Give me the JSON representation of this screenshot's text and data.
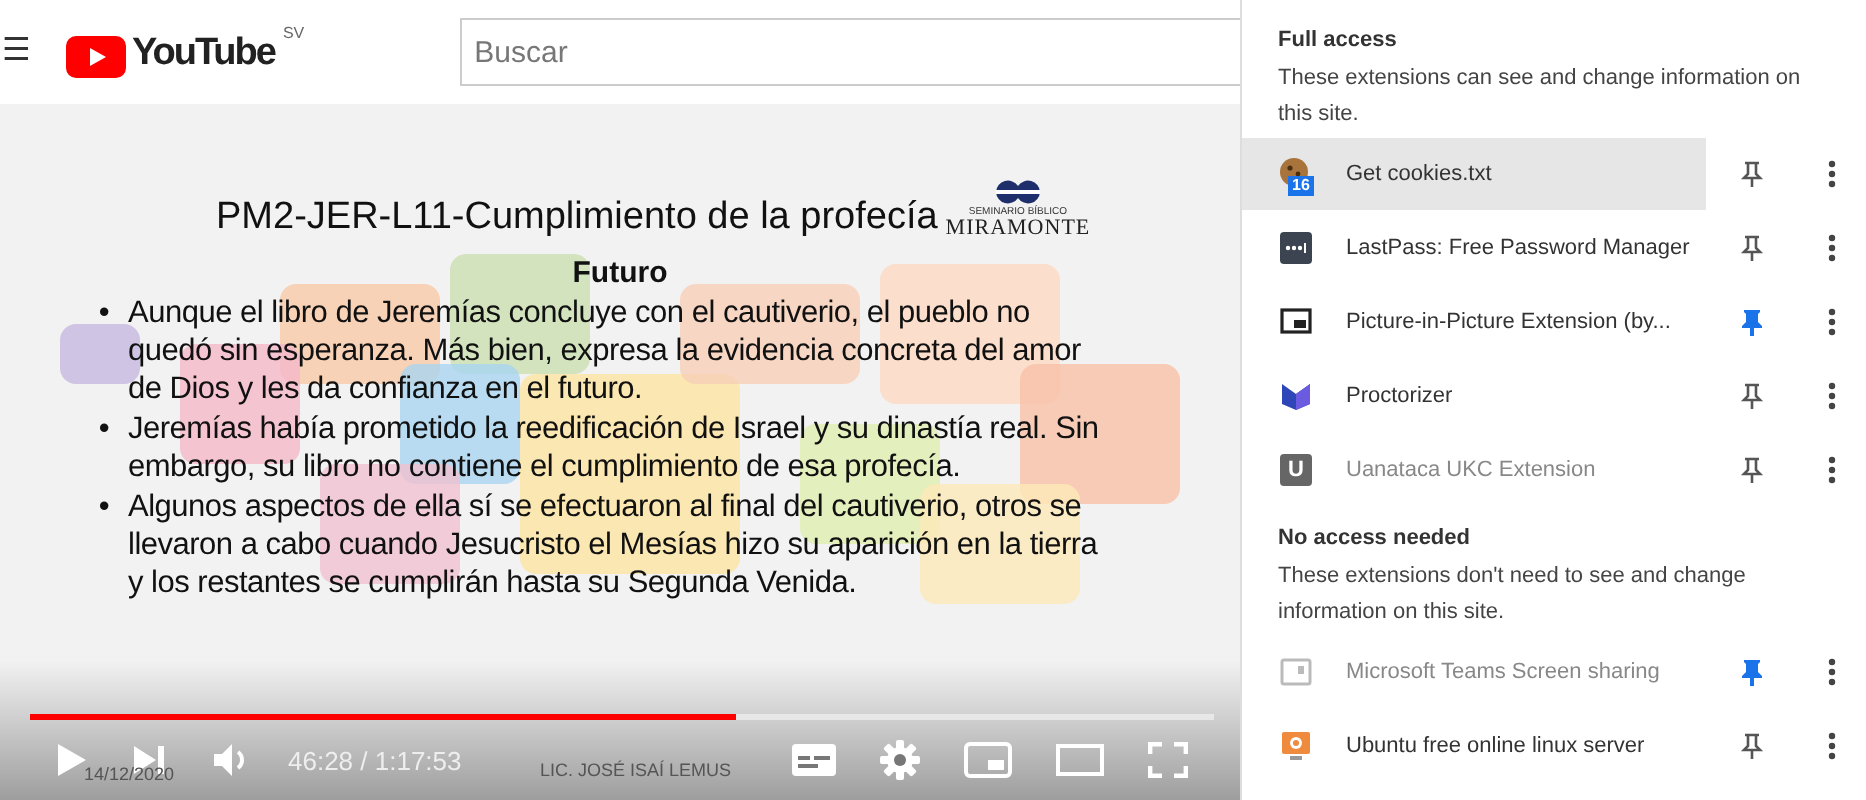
{
  "header": {
    "menu_glyph": "☰",
    "logo_text": "YouTube",
    "country": "SV",
    "search": {
      "placeholder": "Buscar"
    }
  },
  "video": {
    "slide": {
      "title": "PM2-JER-L11-Cumplimiento de la profecía",
      "logo_top": "SEMINARIO BÍBLICO",
      "logo_name": "MIRAMONTE",
      "heading": "Futuro",
      "marker": "•",
      "bullets": [
        "Aunque el libro de Jeremías concluye con el cautiverio, el pueblo no quedó sin esperanza. Más bien, expresa la evidencia concreta del amor de Dios y les da confianza en el futuro.",
        "Jeremías había prometido la reedificación de Israel y su dinastía real. Sin embargo, su libro no contiene el cumplimiento de esa profecía.",
        "Algunos aspectos de ella sí se efectuaron al final del cautiverio, otros se llevaron a cabo cuando Jesucristo el Mesías hizo su aparición en la tierra y los restantes se cumplirán hasta su Segunda Venida."
      ],
      "date": "14/12/2020",
      "author": "LIC. JOSÉ ISAÍ LEMUS"
    },
    "progress": {
      "level": 0.596
    },
    "time": "46:28 / 1:17:53"
  },
  "extensions_panel": {
    "sections": [
      {
        "heading": "Full access",
        "description": "These extensions can see and change information on this site.",
        "items": [
          {
            "name": "Get cookies.txt",
            "badge": "16",
            "highlighted": true,
            "pinned": false,
            "disabled": false
          },
          {
            "name": "LastPass: Free Password Manager",
            "highlighted": false,
            "pinned": false,
            "disabled": false
          },
          {
            "name": "Picture-in-Picture Extension (by...",
            "highlighted": false,
            "pinned": true,
            "disabled": false
          },
          {
            "name": "Proctorizer",
            "highlighted": false,
            "pinned": false,
            "disabled": false
          },
          {
            "name": "Uanataca UKC Extension",
            "letter": "U",
            "highlighted": false,
            "pinned": false,
            "disabled": true
          }
        ]
      },
      {
        "heading": "No access needed",
        "description": "These extensions don't need to see and change information on this site.",
        "items": [
          {
            "name": "Microsoft Teams Screen sharing",
            "highlighted": false,
            "pinned": true,
            "disabled": true
          },
          {
            "name": "Ubuntu free online linux server",
            "highlighted": false,
            "pinned": false,
            "disabled": false
          }
        ]
      }
    ]
  }
}
